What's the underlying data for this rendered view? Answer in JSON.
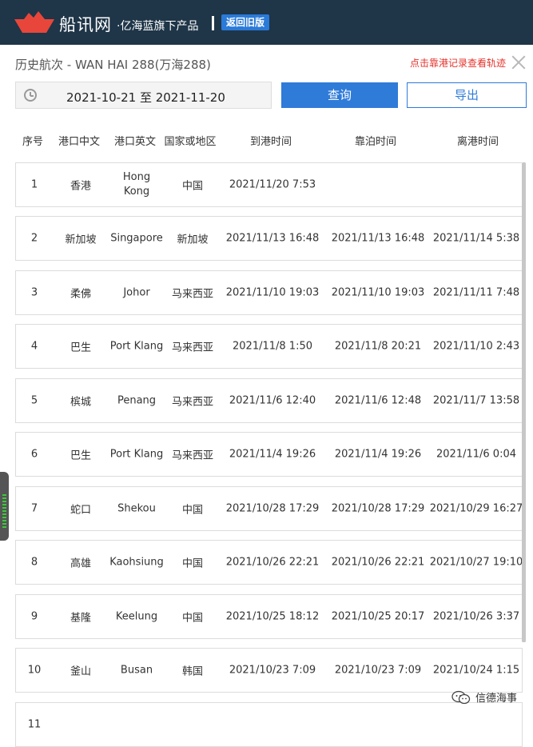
{
  "header": {
    "brand": "船讯网",
    "subtitle": "·亿海蓝旗下产品",
    "old_version_button": "返回旧版"
  },
  "page": {
    "title": "历史航次 - WAN HAI 288(万海288)",
    "hint": "点击靠港记录查看轨迹"
  },
  "controls": {
    "date_range": "2021-10-21 至 2021-11-20",
    "query_button": "查询",
    "export_button": "导出"
  },
  "columns": [
    "序号",
    "港口中文",
    "港口英文",
    "国家或地区",
    "到港时间",
    "靠泊时间",
    "离港时间"
  ],
  "rows": [
    {
      "no": "1",
      "port_cn": "香港",
      "port_en": "Hong Kong",
      "country": "中国",
      "arrival": "2021/11/20 7:53",
      "berth": "",
      "departure": ""
    },
    {
      "no": "2",
      "port_cn": "新加坡",
      "port_en": "Singapore",
      "country": "新加坡",
      "arrival": "2021/11/13 16:48",
      "berth": "2021/11/13 16:48",
      "departure": "2021/11/14 5:38"
    },
    {
      "no": "3",
      "port_cn": "柔佛",
      "port_en": "Johor",
      "country": "马来西亚",
      "arrival": "2021/11/10 19:03",
      "berth": "2021/11/10 19:03",
      "departure": "2021/11/11 7:48"
    },
    {
      "no": "4",
      "port_cn": "巴生",
      "port_en": "Port Klang",
      "country": "马来西亚",
      "arrival": "2021/11/8 1:50",
      "berth": "2021/11/8 20:21",
      "departure": "2021/11/10 2:43"
    },
    {
      "no": "5",
      "port_cn": "槟城",
      "port_en": "Penang",
      "country": "马来西亚",
      "arrival": "2021/11/6 12:40",
      "berth": "2021/11/6 12:48",
      "departure": "2021/11/7 13:58"
    },
    {
      "no": "6",
      "port_cn": "巴生",
      "port_en": "Port Klang",
      "country": "马来西亚",
      "arrival": "2021/11/4 19:26",
      "berth": "2021/11/4 19:26",
      "departure": "2021/11/6 0:04"
    },
    {
      "no": "7",
      "port_cn": "蛇口",
      "port_en": "Shekou",
      "country": "中国",
      "arrival": "2021/10/28 17:29",
      "berth": "2021/10/28 17:29",
      "departure": "2021/10/29 16:27"
    },
    {
      "no": "8",
      "port_cn": "高雄",
      "port_en": "Kaohsiung",
      "country": "中国",
      "arrival": "2021/10/26 22:21",
      "berth": "2021/10/26 22:21",
      "departure": "2021/10/27 19:10"
    },
    {
      "no": "9",
      "port_cn": "基隆",
      "port_en": "Keelung",
      "country": "中国",
      "arrival": "2021/10/25 18:12",
      "berth": "2021/10/25 20:17",
      "departure": "2021/10/26 3:37"
    },
    {
      "no": "10",
      "port_cn": "釜山",
      "port_en": "Busan",
      "country": "韩国",
      "arrival": "2021/10/23 7:09",
      "berth": "2021/10/23 7:09",
      "departure": "2021/10/24 1:15"
    },
    {
      "no": "11",
      "port_cn": "",
      "port_en": "",
      "country": "",
      "arrival": "",
      "berth": "",
      "departure": ""
    }
  ],
  "watermark": "信德海事",
  "colors": {
    "topbar": "#1f3548",
    "accent": "#2f7bd8",
    "hint": "#e4322b",
    "logo": "#e8463a"
  }
}
